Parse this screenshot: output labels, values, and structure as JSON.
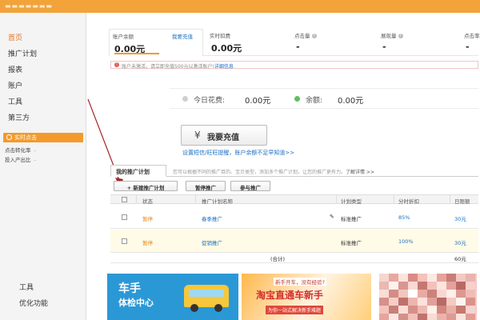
{
  "header": {
    "logo": "▬▬▬▬▬▬▬"
  },
  "sidebar": {
    "items": [
      {
        "label": "首页",
        "active": true
      },
      {
        "label": "推广计划",
        "active": false
      },
      {
        "label": "报表",
        "active": false
      },
      {
        "label": "账户",
        "active": false
      },
      {
        "label": "工具",
        "active": false
      },
      {
        "label": "第三方",
        "active": false
      }
    ],
    "realtime": {
      "label": "实时点击",
      "icon": "clock-icon"
    },
    "sub_stats": [
      {
        "label": "点击转化率",
        "value": "-"
      },
      {
        "label": "投入产出比",
        "value": "-"
      }
    ],
    "lower": [
      "工具",
      "优化功能"
    ]
  },
  "stats": {
    "balance": {
      "label": "账户余额",
      "value": "0.00元",
      "link": "我要充值"
    },
    "realtime_spend": {
      "label": "实时扣费",
      "value": "0.00元"
    },
    "clicks": {
      "label": "点击量",
      "value": "-"
    },
    "impressions": {
      "label": "展现量",
      "value": "-"
    },
    "ctr": {
      "label": "点击率",
      "value": "-"
    }
  },
  "notice": {
    "text": "账户未激活，请立即充值500元以激活账户!",
    "link": "详细信息"
  },
  "today": {
    "spend_label": "今日花费:",
    "spend_value": "0.00元",
    "balance_label": "余额:",
    "balance_value": "0.00元"
  },
  "recharge": {
    "button": "我要充值",
    "yen": "¥",
    "links": "设置短信/旺旺提醒，账户余额不足早知道>>"
  },
  "plans": {
    "tab": "我的推广计划",
    "hint": "您可以根据不同的推广目的、宝贝类型，添加多个推广计划，让您的推广更有力。",
    "hint_link": "了解详情 >>",
    "actions": [
      "+ 新建推广计划",
      "暂停推广",
      "参与推广"
    ],
    "columns": [
      "状态",
      "推广计划名称",
      "计划类型",
      "分时折扣",
      "日限额"
    ],
    "rows": [
      {
        "status": "暂停",
        "name": "春季推广",
        "type": "标准推广",
        "discount": "85%",
        "budget": "30元"
      },
      {
        "status": "暂停",
        "name": "促销推广",
        "type": "标准推广",
        "discount": "100%",
        "budget": "30元"
      }
    ],
    "total_label": "(合计)",
    "total_value": "60元"
  },
  "banners": {
    "b1_line1": "车手",
    "b1_line2": "体检中心",
    "b2_small": "新手开车，没有经验?",
    "b2_big": "淘宝直通车新手",
    "b2_sub": "为你一站式解决新手难题"
  },
  "colors": {
    "accent": "#f39a2c",
    "link": "#1a6fc4",
    "status": "#e08a1a"
  }
}
